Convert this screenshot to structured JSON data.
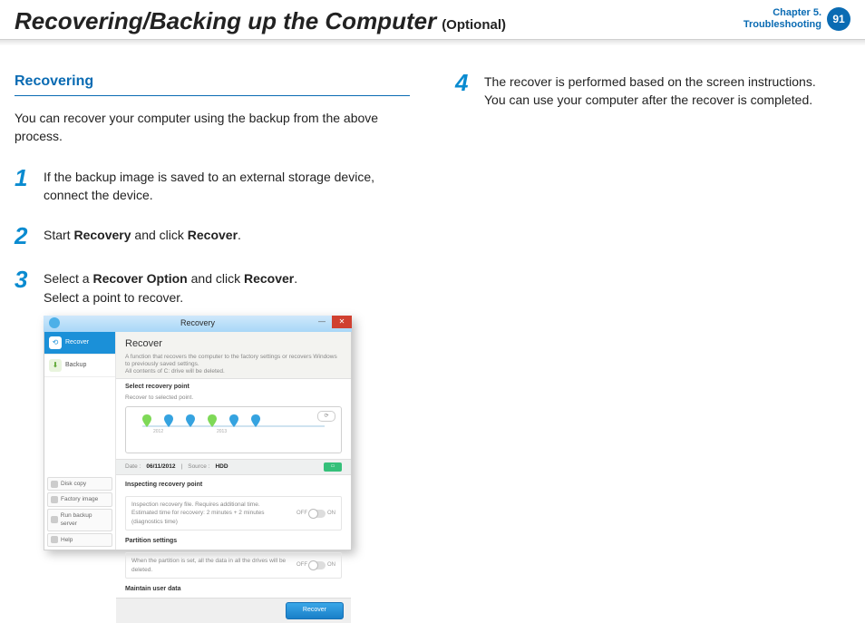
{
  "header": {
    "title": "Recovering/Backing up the Computer",
    "suffix": "(Optional)",
    "chapter_line1": "Chapter 5.",
    "chapter_line2": "Troubleshooting",
    "page_number": "91"
  },
  "left": {
    "section_heading": "Recovering",
    "intro": "You can recover your computer using the backup from the above process.",
    "step1": {
      "num": "1",
      "text": "If the backup image is saved to an external storage device, connect the device."
    },
    "step2": {
      "num": "2",
      "prefix": "Start ",
      "b1": "Recovery",
      "mid": " and click ",
      "b2": "Recover",
      "suffix": "."
    },
    "step3": {
      "num": "3",
      "prefix": "Select a ",
      "b1": "Recover Option",
      "mid": " and click ",
      "b2": "Recover",
      "suffix": ".",
      "line2": "Select a point to recover."
    }
  },
  "right": {
    "step4": {
      "num": "4",
      "line1": "The recover is performed based on the screen instructions.",
      "line2": "You can use your computer after the recover is completed."
    }
  },
  "shot": {
    "window_title": "Recovery",
    "close": "✕",
    "min": "—",
    "sidebar": {
      "recover": "Recover",
      "backup": "Backup",
      "disk_copy": "Disk copy",
      "factory_image": "Factory image",
      "run_backup_server": "Run backup server",
      "help": "Help"
    },
    "main": {
      "heading": "Recover",
      "desc1": "A function that recovers the computer to the factory settings or recovers Windows to previously saved settings.",
      "desc2": "All contents of C: drive will be deleted.",
      "sec_select_title": "Select recovery point",
      "sec_select_sub": "Recover to selected point.",
      "tick_a": "2012",
      "tick_b": "2013",
      "refresh": "⟳",
      "meta_date_label": "Date :",
      "meta_date_value": "06/11/2012",
      "meta_source_label": "Source :",
      "meta_source_value": "HDD",
      "sec_inspect_title": "Inspecting recovery point",
      "inspect_line1": "Inspection recovery file. Requires additional time.",
      "inspect_line2": "Estimated time for recovery: 2 minutes + 2 minutes (diagnostics time)",
      "off": "OFF",
      "on": "ON",
      "sec_partition_title": "Partition settings",
      "partition_line": "When the partition is set, all the data in all the drives will be deleted.",
      "sec_maintain_title": "Maintain user data",
      "recover_btn": "Recover"
    }
  }
}
